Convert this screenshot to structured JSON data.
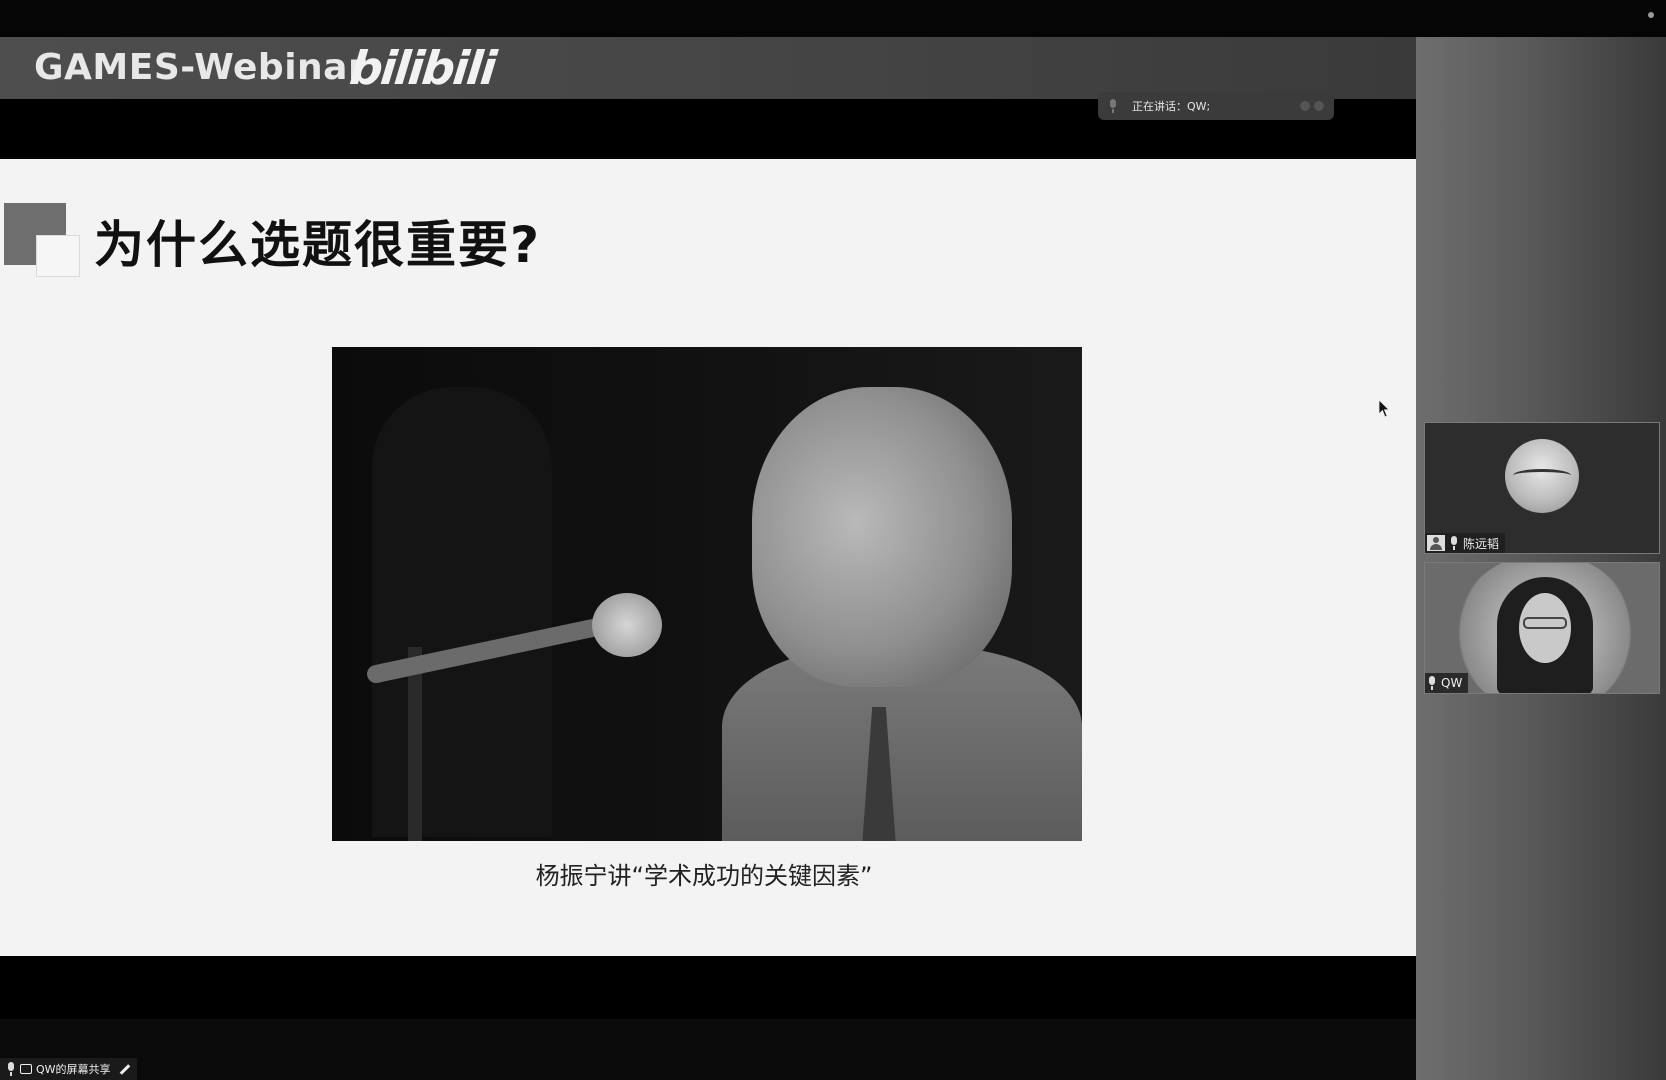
{
  "banner": {
    "title": "GAMES-Webinar",
    "logo_text": "bilibili"
  },
  "speaking": {
    "label": "正在讲话：",
    "speaker": "QW;"
  },
  "slide": {
    "title": "为什么选题很重要?",
    "caption": "杨振宁讲“学术成功的关键因素”"
  },
  "participants": [
    {
      "name": "陈远韬",
      "has_video": false
    },
    {
      "name": "QW",
      "has_video": true
    }
  ],
  "share_badge": {
    "label": "QW的屏幕共享"
  }
}
